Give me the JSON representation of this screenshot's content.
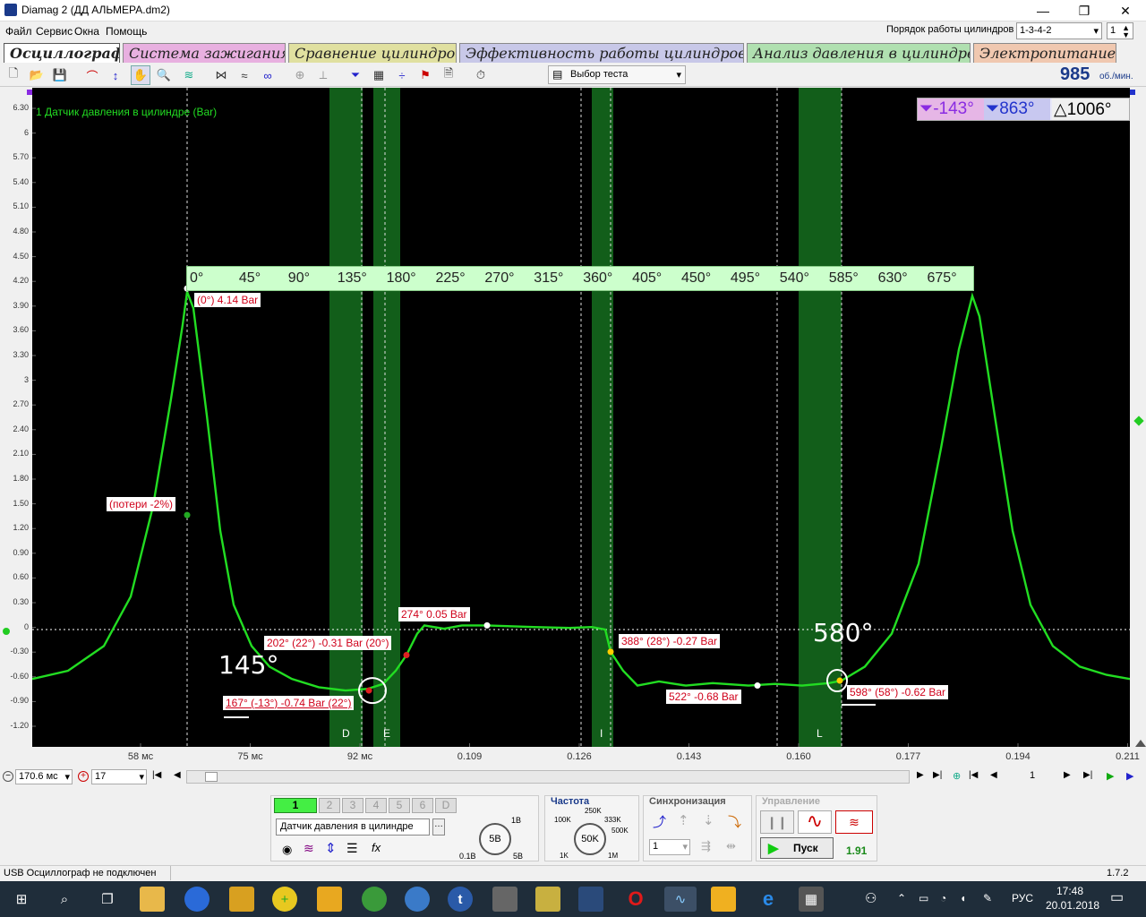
{
  "window": {
    "title": "Diamag 2 (ДД АЛЬМЕРА.dm2)",
    "min": "—",
    "max": "❐",
    "close": "✕"
  },
  "menu": [
    "Файл",
    "Сервис",
    "Окна",
    "Помощь"
  ],
  "cylinder_order": {
    "label": "Порядок работы цилиндров",
    "value": "1-3-4-2",
    "number": "1"
  },
  "tabs": [
    {
      "label": "Осциллограф",
      "color": "#ffffff"
    },
    {
      "label": "Система зажигания",
      "color": "#e8b0e0"
    },
    {
      "label": "Сравнение цилиндров",
      "color": "#e0e0a0"
    },
    {
      "label": "Эффективность работы цилиндров",
      "color": "#c8c8e8"
    },
    {
      "label": "Анализ давления в цилиндре",
      "color": "#b0e0b0"
    },
    {
      "label": "Электропитание",
      "color": "#f0c8b0"
    }
  ],
  "toolbar": {
    "test_select": "Выбор теста",
    "rpm_value": "985",
    "rpm_unit": "об./мин."
  },
  "plot": {
    "channel_title": "1 Датчик давления в цилиндре (Bar)",
    "measure": {
      "cursor1": "-143°",
      "cursor2": "863°",
      "delta": "1006°"
    },
    "y_ticks": [
      "6.30",
      "6",
      "5.70",
      "5.40",
      "5.10",
      "4.80",
      "4.50",
      "4.20",
      "3.90",
      "3.60",
      "3.30",
      "3",
      "2.70",
      "2.40",
      "2.10",
      "1.80",
      "1.50",
      "1.20",
      "0.90",
      "0.60",
      "0.30",
      "0",
      "-0.30",
      "-0.60",
      "-0.90",
      "-1.20"
    ],
    "x_ticks": [
      "58 мс",
      "75 мс",
      "92 мс",
      "0.109",
      "0.126",
      "0.143",
      "0.160",
      "0.177",
      "0.194",
      "0.211"
    ],
    "degree_scale": [
      "0°",
      "45°",
      "90°",
      "135°",
      "180°",
      "225°",
      "270°",
      "315°",
      "360°",
      "405°",
      "450°",
      "495°",
      "540°",
      "585°",
      "630°",
      "675°"
    ],
    "zones": [
      "D",
      "E",
      "I",
      "L"
    ],
    "annotations": [
      "(0°) 4.14 Bar",
      "(потери -2%)",
      "202° (22°) -0.31 Bar (20°)",
      "167° (-13°) -0.74 Bar (22°)",
      "274° 0.05 Bar",
      "388° (28°) -0.27 Bar",
      "522° -0.68 Bar",
      "598° (58°) -0.62 Bar"
    ],
    "handwritten": [
      "145°",
      "580°"
    ],
    "trace_color": "#22dd22"
  },
  "bottom": {
    "timebase": "170.6 мс",
    "value": "17",
    "page": "1"
  },
  "control": {
    "channels": [
      "1",
      "2",
      "3",
      "4",
      "5",
      "6",
      "D"
    ],
    "sensor": "Датчик давления в цилиндре",
    "volt_knob": "5В",
    "volt_labels": [
      "1В",
      "0.1В",
      "5В"
    ],
    "freq_title": "Частота",
    "freq_knob": "50K",
    "freq_labels": [
      "250K",
      "100K",
      "333K",
      "500K",
      "1K",
      "1M"
    ],
    "sync_title": "Синхронизация",
    "sync_value": "1",
    "mgmt_title": "Управление",
    "start": "Пуск",
    "version_small": "1.91"
  },
  "status": {
    "text": "USB Осциллограф не подключен",
    "version": "1.7.2"
  },
  "taskbar": {
    "lang": "РУС",
    "time": "17:48",
    "date": "20.01.2018"
  }
}
